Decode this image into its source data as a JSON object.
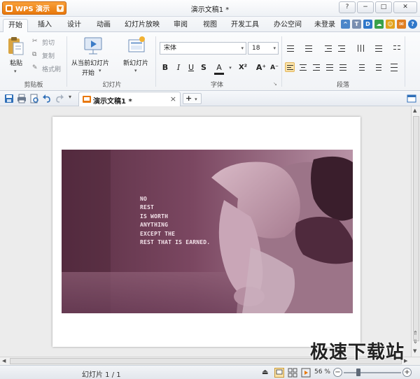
{
  "app": {
    "name": "WPS 演示",
    "document_title": "演示文稿1 *"
  },
  "window_controls": {
    "help": "?",
    "minimize": "−",
    "restore": "□",
    "close": "✕"
  },
  "menu": {
    "tabs": [
      "开始",
      "插入",
      "设计",
      "动画",
      "幻灯片放映",
      "审阅",
      "视图",
      "开发工具",
      "办公空间",
      "未登录"
    ],
    "active_index": 0
  },
  "ribbon": {
    "clipboard": {
      "paste": "粘贴",
      "cut": "剪切",
      "copy": "复制",
      "format_painter": "格式刷",
      "group_label": "剪贴板"
    },
    "slides": {
      "from_current_line1": "从当前幻灯片",
      "from_current_line2": "开始",
      "new_slide": "新幻灯片",
      "group_label": "幻灯片"
    },
    "font": {
      "font_name": "宋体",
      "font_size": "18",
      "bold": "B",
      "italic": "I",
      "underline": "U",
      "strike": "S",
      "color": "A",
      "superscript": "X²",
      "grow": "A⁺",
      "shrink": "A⁻",
      "group_label": "字体"
    },
    "paragraph": {
      "group_label": "段落"
    }
  },
  "quick_toolbar": {
    "doc_tab": "演示文稿1 *",
    "close_tab": "×",
    "add_tab": "+"
  },
  "slide": {
    "quote_lines": [
      "NO",
      "REST",
      "IS WORTH",
      "ANYTHING",
      "EXCEPT THE",
      "REST THAT IS EARNED."
    ]
  },
  "status_bar": {
    "slide_indicator": "幻灯片 1 / 1",
    "zoom": "56 %",
    "zoom_level": 0.56
  },
  "watermark": "极速下载站",
  "colors": {
    "accent": "#e8780c",
    "slide_tint": "#7a4660",
    "quote_text": "#f3e3ea"
  }
}
